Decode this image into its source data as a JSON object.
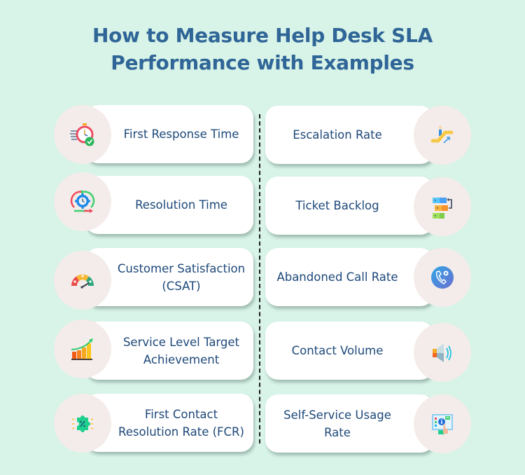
{
  "title": {
    "line1": "How to Measure Help Desk SLA",
    "line2": "Performance with Examples"
  },
  "colors": {
    "background": "#d8f3e7",
    "title": "#2f6597",
    "card_text": "#1d4879",
    "card_bg": "#ffffff",
    "circle_bg": "#f4ecea"
  },
  "left_items": [
    {
      "label": "First Response Time",
      "icon": "stopwatch-check-icon"
    },
    {
      "label": "Resolution Time",
      "icon": "gear-clock-cycle-icon"
    },
    {
      "label": "Customer Satisfaction (CSAT)",
      "icon": "satisfaction-gauge-icon"
    },
    {
      "label": "Service Level Target Achievement",
      "icon": "growth-bar-chart-icon"
    },
    {
      "label": "First Contact Resolution Rate (FCR)",
      "icon": "puzzle-percent-icon"
    }
  ],
  "right_items": [
    {
      "label": "Escalation Rate",
      "icon": "escalator-icon"
    },
    {
      "label": "Ticket Backlog",
      "icon": "stacked-tickets-icon"
    },
    {
      "label": "Abandoned Call Rate",
      "icon": "phone-call-icon"
    },
    {
      "label": "Contact Volume",
      "icon": "speaker-volume-icon"
    },
    {
      "label": "Self-Service Usage Rate",
      "icon": "info-screen-touch-icon"
    }
  ]
}
